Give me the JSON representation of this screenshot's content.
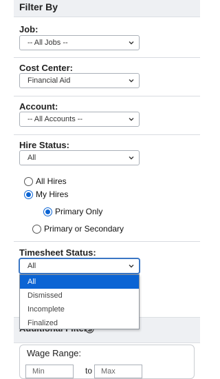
{
  "header": {
    "title": "Filter By"
  },
  "job": {
    "label": "Job:",
    "value": "-- All Jobs --"
  },
  "cost_center": {
    "label": "Cost Center:",
    "value": "Financial Aid"
  },
  "account": {
    "label": "Account:",
    "value": "-- All Accounts --"
  },
  "hire_status": {
    "label": "Hire Status:",
    "value": "All",
    "radios": {
      "all_hires": {
        "label": "All Hires",
        "checked": false
      },
      "my_hires": {
        "label": "My Hires",
        "checked": true
      },
      "primary_only": {
        "label": "Primary Only",
        "checked": true
      },
      "primary_or_secondary": {
        "label": "Primary or Secondary",
        "checked": false
      }
    }
  },
  "timesheet_status": {
    "label": "Timesheet Status:",
    "value": "All",
    "options": [
      "All",
      "Dismissed",
      "Incomplete",
      "Finalized"
    ],
    "selected": "All"
  },
  "additional_filters": {
    "title": "Additional Filters"
  },
  "wage_range": {
    "label": "Wage Range:",
    "min_placeholder": "Min",
    "to": "to",
    "max_placeholder": "Max"
  },
  "icons": {
    "chevron": "chevron-down-icon",
    "info": "info-icon"
  },
  "colors": {
    "accent": "#0b64d4",
    "panel_bg": "#eef0f3"
  }
}
